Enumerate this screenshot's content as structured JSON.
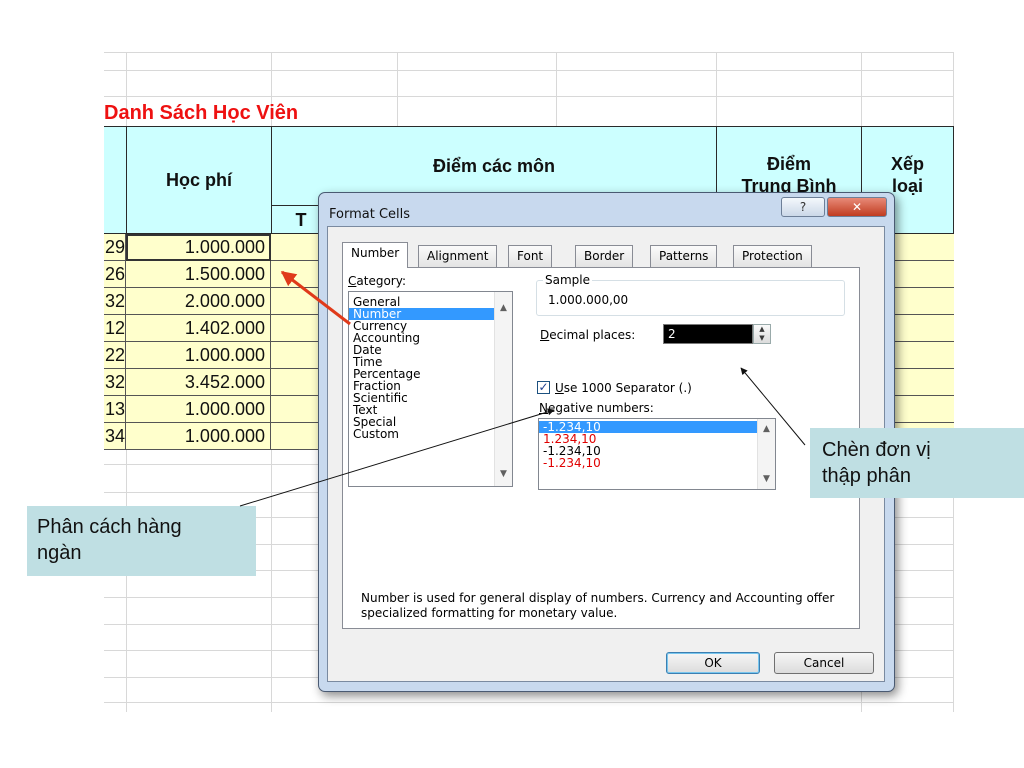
{
  "sheet": {
    "title": "Danh Sách Học Viên",
    "headers": {
      "hocphi": "Học phí",
      "diem_cac_mon": "Điểm các môn",
      "sub_first": "T",
      "diem_tb_line1": "Điểm",
      "diem_tb_line2": "Trung Bình",
      "xep_loai_line1": "Xếp",
      "xep_loai_line2": "loại"
    },
    "rows": [
      {
        "a": "29",
        "fee": "1.000.000"
      },
      {
        "a": "26",
        "fee": "1.500.000"
      },
      {
        "a": "32",
        "fee": "2.000.000"
      },
      {
        "a": "12",
        "fee": "1.402.000"
      },
      {
        "a": "22",
        "fee": "1.000.000"
      },
      {
        "a": "32",
        "fee": "3.452.000"
      },
      {
        "a": "13",
        "fee": "1.000.000"
      },
      {
        "a": "34",
        "fee": "1.000.000"
      }
    ]
  },
  "dialog": {
    "title": "Format Cells",
    "help_icon": "help-icon",
    "close_icon": "close-icon",
    "tabs": [
      {
        "label": "Number",
        "active": true
      },
      {
        "label": "Alignment",
        "active": false
      },
      {
        "label": "Font",
        "active": false
      },
      {
        "label": "Border",
        "active": false
      },
      {
        "label": "Patterns",
        "active": false
      },
      {
        "label": "Protection",
        "active": false
      }
    ],
    "category": {
      "label_u": "C",
      "label_rest": "ategory:",
      "items": [
        "General",
        "Number",
        "Currency",
        "Accounting",
        "Date",
        "Time",
        "Percentage",
        "Fraction",
        "Scientific",
        "Text",
        "Special",
        "Custom"
      ],
      "selected": "Number"
    },
    "sample": {
      "label": "Sample",
      "value": "1.000.000,00"
    },
    "decimal": {
      "label_u": "D",
      "label_rest": "ecimal places:",
      "value": "2"
    },
    "separator": {
      "checked": true,
      "label_u": "U",
      "label_rest": "se 1000 Separator (.)"
    },
    "negative": {
      "label_u": "N",
      "label_rest": "egative numbers:",
      "items": [
        {
          "text": "-1.234,10",
          "color": "#000000",
          "selected": true
        },
        {
          "text": "1.234,10",
          "color": "#e00000",
          "selected": false
        },
        {
          "text": "-1.234,10",
          "color": "#000000",
          "selected": false
        },
        {
          "text": "-1.234,10",
          "color": "#e00000",
          "selected": false
        }
      ]
    },
    "description": "Number is used for general display of numbers.  Currency and Accounting offer specialized formatting for monetary value.",
    "ok_label": "OK",
    "cancel_label": "Cancel"
  },
  "callouts": {
    "decimal_line1": "Chèn đơn vị",
    "decimal_line2": "thập phân",
    "separator_line1": "Phân cách hàng",
    "separator_line2": "ngàn"
  },
  "colors": {
    "title_red": "#ee1111",
    "header_cyan": "#ccffff",
    "cell_yellow": "#ffffcc",
    "callout_bg": "#bfdfe3",
    "selection_blue": "#3399ff",
    "arrow_red": "#e03a1a"
  }
}
